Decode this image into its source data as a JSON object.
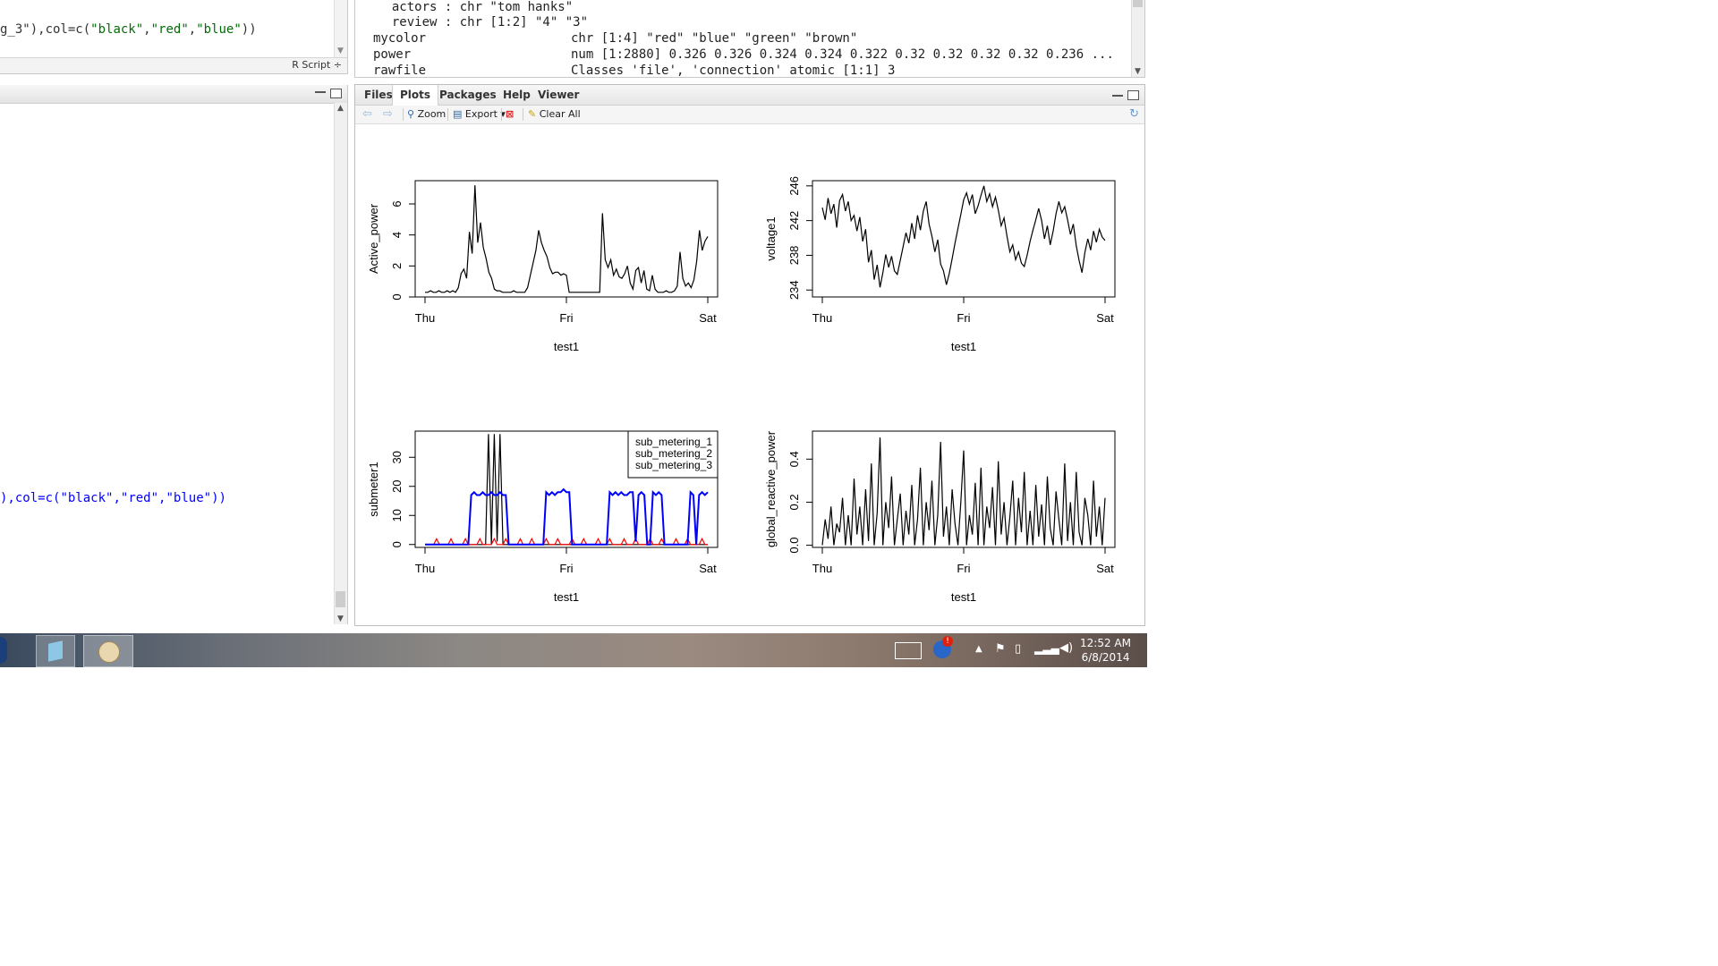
{
  "script_pane": {
    "line_part1": "g_3\"),col=c(",
    "str1": "\"black\"",
    "comma1": ",",
    "str2": "\"red\"",
    "comma2": ",",
    "str3": "\"blue\"",
    "line_end": "))",
    "file_type_label": "R Script ÷"
  },
  "console_pane": {
    "line_part1": "),col=c(",
    "str1": "\"black\"",
    "comma1": ",",
    "str2": "\"red\"",
    "comma2": ",",
    "str3": "\"blue\"",
    "line_end": "))"
  },
  "environment": {
    "rows": [
      {
        "name": "  actors : chr \"tom hanks\"",
        "value": ""
      },
      {
        "name": "  review : chr [1:2] \"4\" \"3\"",
        "value": ""
      },
      {
        "name": "mycolor",
        "value": "chr [1:4] \"red\" \"blue\" \"green\" \"brown\""
      },
      {
        "name": "power",
        "value": "num [1:2880] 0.326 0.326 0.324 0.324 0.322 0.32 0.32 0.32 0.32 0.236 ..."
      },
      {
        "name": "rawfile",
        "value": "Classes 'file', 'connection' atomic [1:1] 3"
      }
    ]
  },
  "plots_pane": {
    "tabs": [
      "Files",
      "Plots",
      "Packages",
      "Help",
      "Viewer"
    ],
    "active_tab": "Plots",
    "toolbar": {
      "zoom_label": "Zoom",
      "export_label": "Export ▾",
      "clear_all_label": "Clear All"
    }
  },
  "taskbar": {
    "time": "12:52 AM",
    "date": "6/8/2014"
  },
  "chart_data": [
    {
      "type": "line",
      "xlabel": "test1",
      "ylabel": "Active_power",
      "x_ticks": [
        "Thu",
        "Fri",
        "Sat"
      ],
      "y_ticks": [
        0,
        2,
        4,
        6
      ],
      "ylim": [
        0,
        7.5
      ],
      "series": [
        {
          "color": "#000000",
          "values": [
            0.3,
            0.3,
            0.4,
            0.3,
            0.3,
            0.4,
            0.3,
            0.3,
            0.4,
            0.3,
            0.4,
            0.3,
            0.6,
            1.5,
            1.8,
            1.2,
            4.2,
            2.8,
            7.2,
            3.5,
            4.8,
            3.2,
            2.5,
            1.6,
            1.2,
            0.5,
            0.4,
            0.4,
            0.3,
            0.3,
            0.3,
            0.3,
            0.4,
            0.3,
            0.3,
            0.3,
            0.3,
            0.6,
            1.4,
            2.2,
            3.0,
            4.3,
            3.5,
            3.0,
            2.6,
            1.9,
            1.5,
            1.6,
            1.6,
            1.4,
            1.5,
            1.4,
            0.3,
            0.3,
            0.3,
            0.3,
            0.3,
            0.3,
            0.3,
            0.3,
            0.3,
            0.3,
            0.3,
            0.3,
            5.4,
            2.4,
            1.9,
            2.4,
            1.4,
            1.8,
            1.3,
            1.2,
            1.5,
            2.0,
            0.9,
            0.5,
            1.7,
            1.9,
            0.9,
            1.7,
            0.5,
            0.4,
            1.4,
            0.5,
            0.3,
            0.3,
            0.3,
            0.4,
            0.3,
            0.3,
            0.4,
            0.7,
            2.9,
            1.2,
            0.7,
            0.9,
            0.6,
            1.1,
            2.3,
            4.3,
            3.0,
            3.6,
            3.9
          ]
        }
      ]
    },
    {
      "type": "line",
      "xlabel": "test1",
      "ylabel": "voltage1",
      "x_ticks": [
        "Thu",
        "Fri",
        "Sat"
      ],
      "y_ticks": [
        234,
        238,
        242,
        246
      ],
      "ylim": [
        233.2,
        246.6
      ],
      "series": [
        {
          "color": "#000000",
          "values": [
            243.5,
            242.1,
            244.6,
            242.8,
            243.9,
            241.2,
            244.3,
            245.0,
            243.1,
            244.2,
            242.0,
            242.6,
            240.8,
            242.4,
            239.6,
            241.0,
            237.2,
            238.6,
            235.2,
            236.9,
            234.3,
            236.0,
            238.1,
            236.6,
            237.9,
            236.2,
            235.8,
            237.4,
            239.0,
            240.6,
            239.4,
            241.7,
            239.9,
            242.6,
            240.9,
            243.1,
            244.2,
            241.6,
            240.2,
            238.4,
            239.8,
            237.0,
            236.2,
            234.6,
            235.9,
            237.6,
            239.4,
            241.1,
            242.7,
            244.4,
            245.2,
            243.9,
            245.0,
            242.8,
            243.7,
            244.9,
            246.0,
            244.2,
            245.1,
            243.6,
            244.7,
            243.2,
            241.4,
            242.3,
            240.2,
            238.4,
            239.2,
            237.5,
            238.4,
            237.1,
            236.7,
            238.0,
            239.6,
            240.9,
            242.1,
            243.4,
            242.0,
            239.9,
            241.4,
            239.2,
            240.8,
            242.8,
            244.2,
            242.9,
            243.6,
            242.1,
            240.4,
            241.6,
            239.1,
            237.4,
            236.0,
            238.3,
            239.9,
            238.6,
            240.8,
            239.5,
            241.0,
            240.1,
            239.7
          ]
        }
      ]
    },
    {
      "type": "line",
      "xlabel": "test1",
      "ylabel": "submeter1",
      "x_ticks": [
        "Thu",
        "Fri",
        "Sat"
      ],
      "y_ticks": [
        0,
        10,
        20,
        30
      ],
      "ylim": [
        -1,
        39
      ],
      "legend": {
        "position": "top-right",
        "entries": [
          "sub_metering_1",
          "sub_metering_2",
          "sub_metering_3"
        ]
      },
      "series": [
        {
          "name": "sub_metering_1",
          "color": "#000000",
          "values": [
            0,
            0,
            0,
            0,
            0,
            0,
            0,
            0,
            0,
            0,
            0,
            0,
            0,
            0,
            0,
            0,
            0,
            0,
            0,
            0,
            0,
            0,
            38,
            0,
            38,
            1,
            38,
            0,
            0,
            0,
            0,
            0,
            0,
            0,
            0,
            0,
            0,
            0,
            0,
            0,
            0,
            0,
            0,
            0,
            0,
            0,
            0,
            0,
            0,
            0,
            0,
            0,
            0,
            0,
            0,
            0,
            0,
            0,
            0,
            0,
            0,
            0,
            0,
            0,
            0,
            0,
            0,
            0,
            0,
            0,
            0,
            0,
            0,
            0,
            0,
            0,
            0,
            0,
            0,
            0,
            0,
            0,
            0,
            0,
            0,
            0,
            0,
            0,
            0,
            0,
            0,
            0,
            0,
            0,
            0,
            0,
            0,
            0,
            0
          ]
        },
        {
          "name": "sub_metering_2",
          "color": "#ff0000",
          "values": [
            0,
            0,
            0,
            0,
            2,
            0,
            0,
            0,
            0,
            2,
            0,
            0,
            0,
            0,
            2,
            0,
            0,
            0,
            0,
            2,
            0,
            0,
            0,
            0,
            2,
            0,
            0,
            0,
            2,
            0,
            0,
            0,
            0,
            2,
            0,
            0,
            0,
            2,
            0,
            0,
            0,
            0,
            2,
            0,
            0,
            0,
            2,
            0,
            0,
            0,
            0,
            2,
            0,
            0,
            0,
            2,
            0,
            0,
            0,
            0,
            2,
            0,
            0,
            0,
            2,
            0,
            0,
            0,
            0,
            2,
            0,
            0,
            0,
            2,
            0,
            0,
            0,
            0,
            2,
            0,
            0,
            0,
            2,
            0,
            0,
            0,
            0,
            2,
            0,
            0,
            0,
            2,
            0,
            0,
            0,
            0,
            2,
            0,
            0
          ]
        },
        {
          "name": "sub_metering_3",
          "color": "#0000ff",
          "values": [
            0,
            0,
            0,
            0,
            0,
            0,
            0,
            0,
            0,
            0,
            0,
            0,
            0,
            0,
            0,
            0,
            17,
            18,
            17,
            17,
            18,
            17,
            17,
            18,
            17,
            17,
            18,
            17,
            17,
            0,
            0,
            0,
            0,
            0,
            0,
            0,
            0,
            0,
            0,
            0,
            0,
            0,
            18,
            17,
            18,
            17,
            18,
            18,
            19,
            18,
            18,
            0,
            0,
            0,
            0,
            0,
            0,
            0,
            0,
            0,
            0,
            0,
            0,
            0,
            18,
            17,
            18,
            17,
            18,
            17,
            17,
            18,
            18,
            1,
            17,
            18,
            17,
            0,
            0,
            18,
            17,
            18,
            17,
            0,
            0,
            0,
            0,
            0,
            0,
            0,
            0,
            0,
            18,
            17,
            0,
            17,
            18,
            17,
            18
          ]
        }
      ]
    },
    {
      "type": "line",
      "xlabel": "test1",
      "ylabel": "global_reactive_power",
      "x_ticks": [
        "Thu",
        "Fri",
        "Sat"
      ],
      "y_ticks": [
        "0.0",
        "0.2",
        "0.4"
      ],
      "ylim": [
        -0.01,
        0.53
      ],
      "series": [
        {
          "color": "#000000",
          "values": [
            0.0,
            0.12,
            0.03,
            0.18,
            0.0,
            0.1,
            0.06,
            0.22,
            0.0,
            0.14,
            0.0,
            0.31,
            0.05,
            0.18,
            0.0,
            0.26,
            0.02,
            0.38,
            0.0,
            0.15,
            0.5,
            0.0,
            0.2,
            0.08,
            0.32,
            0.0,
            0.12,
            0.24,
            0.0,
            0.16,
            0.05,
            0.28,
            0.0,
            0.12,
            0.36,
            0.0,
            0.2,
            0.07,
            0.3,
            0.0,
            0.14,
            0.48,
            0.04,
            0.18,
            0.0,
            0.26,
            0.1,
            0.0,
            0.2,
            0.44,
            0.0,
            0.14,
            0.05,
            0.29,
            0.0,
            0.36,
            0.0,
            0.18,
            0.08,
            0.27,
            0.0,
            0.39,
            0.05,
            0.2,
            0.0,
            0.13,
            0.3,
            0.0,
            0.22,
            0.06,
            0.34,
            0.0,
            0.16,
            0.0,
            0.28,
            0.04,
            0.19,
            0.0,
            0.32,
            0.08,
            0.0,
            0.25,
            0.12,
            0.0,
            0.38,
            0.02,
            0.2,
            0.0,
            0.34,
            0.06,
            0.0,
            0.22,
            0.14,
            0.0,
            0.3,
            0.04,
            0.18,
            0.0,
            0.22
          ]
        }
      ]
    }
  ]
}
